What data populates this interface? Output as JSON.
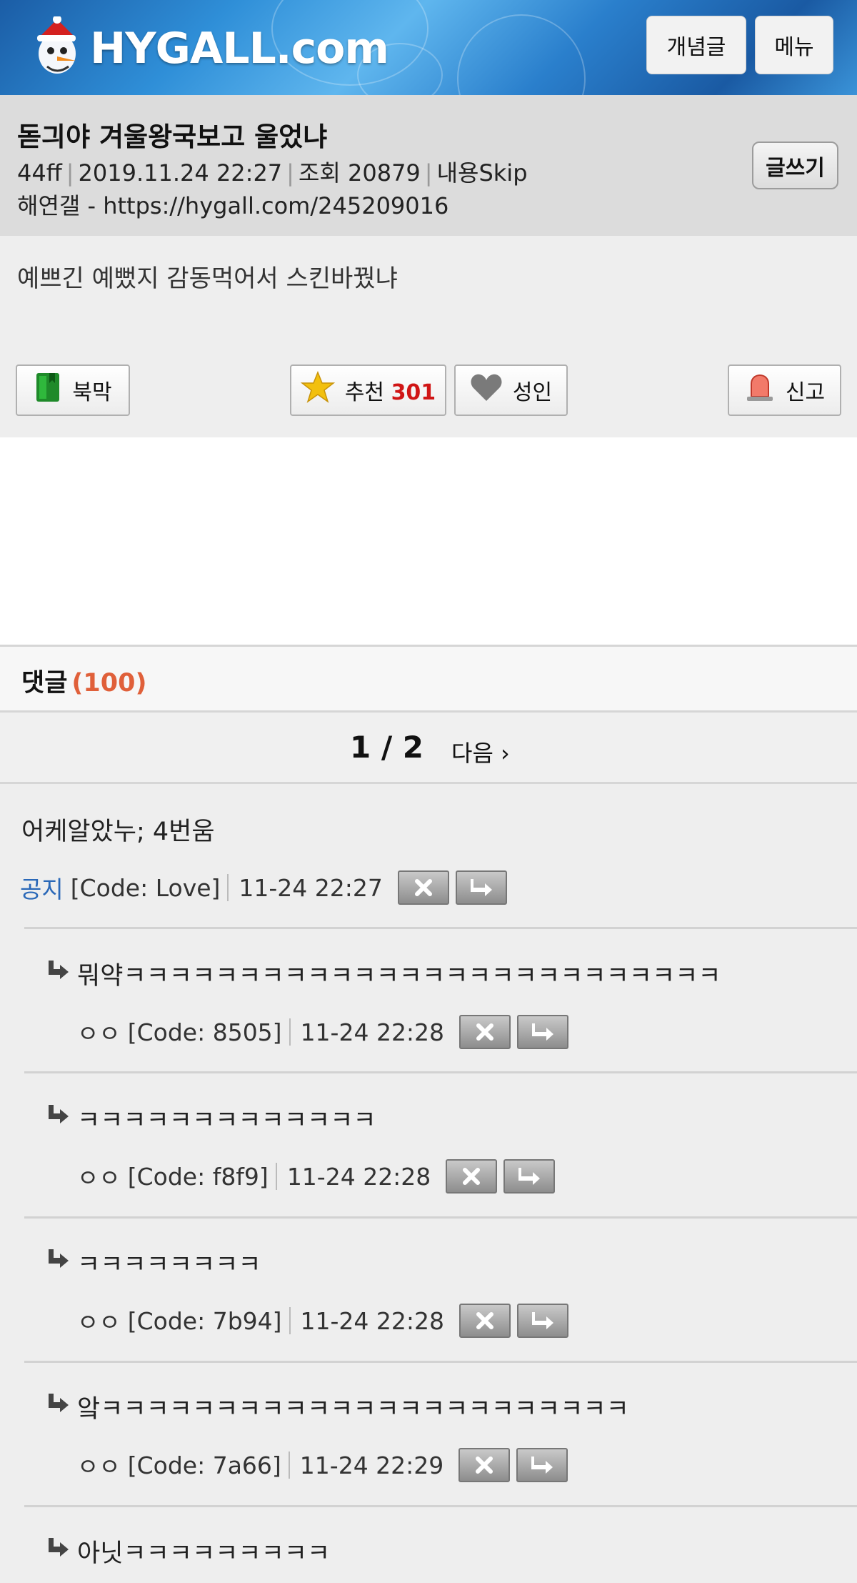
{
  "site": {
    "logo_text": "HYGALL.com",
    "concept_button": "개념글",
    "menu_button": "메뉴"
  },
  "post": {
    "title": "돋긔야 겨울왕국보고 울었냐",
    "author": "44ff",
    "datetime": "2019.11.24 22:27",
    "views_label": "조회 20879",
    "skip_label": "내용Skip",
    "link": "해연갤 - https://hygall.com/245209016",
    "write_button": "글쓰기",
    "content": "예쁘긴 예뻤지 감동먹어서 스킨바꿨냐",
    "actions": {
      "bookmark": "북막",
      "recommend": "추천",
      "recommend_count": "301",
      "adult": "성인",
      "report": "신고"
    }
  },
  "comments_section": {
    "label": "댓글",
    "count": "(100)",
    "pager": "1 / 2",
    "next": "다음 ›"
  },
  "comments": [
    {
      "text": "어케알았누; 4번움",
      "nick": "공지",
      "code": "[Code: Love]",
      "time": "11-24 22:27"
    },
    {
      "text": "뭐약ㅋㅋㅋㅋㅋㅋㅋㅋㅋㅋㅋㅋㅋㅋㅋㅋㅋㅋㅋㅋㅋㅋㅋㅋㅋㅋ",
      "nick": "ㅇㅇ",
      "code": "[Code: 8505]",
      "time": "11-24 22:28"
    },
    {
      "text": "ㅋㅋㅋㅋㅋㅋㅋㅋㅋㅋㅋㅋㅋ",
      "nick": "ㅇㅇ",
      "code": "[Code: f8f9]",
      "time": "11-24 22:28"
    },
    {
      "text": "ㅋㅋㅋㅋㅋㅋㅋㅋ",
      "nick": "ㅇㅇ",
      "code": "[Code: 7b94]",
      "time": "11-24 22:28"
    },
    {
      "text": "앜ㅋㅋㅋㅋㅋㅋㅋㅋㅋㅋㅋㅋㅋㅋㅋㅋㅋㅋㅋㅋㅋㅋㅋ",
      "nick": "ㅇㅇ",
      "code": "[Code: 7a66]",
      "time": "11-24 22:29"
    },
    {
      "text": "아닛ㅋㅋㅋㅋㅋㅋㅋㅋㅋ",
      "nick": "",
      "code": "",
      "time": ""
    }
  ]
}
